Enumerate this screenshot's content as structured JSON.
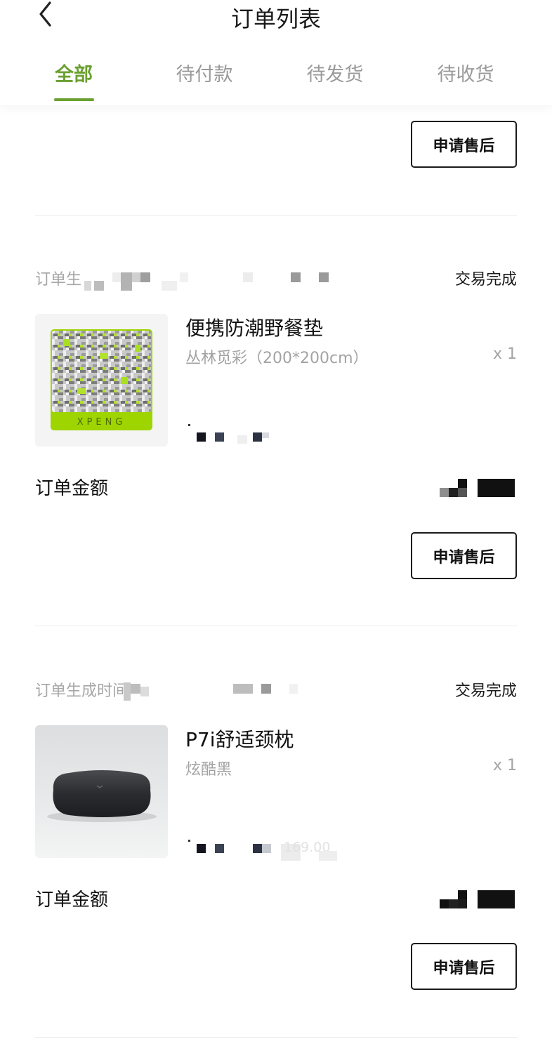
{
  "header": {
    "title": "订单列表",
    "back_icon": "chevron-left-icon"
  },
  "tabs": [
    {
      "label": "全部",
      "active": true
    },
    {
      "label": "待付款",
      "active": false
    },
    {
      "label": "待发货",
      "active": false
    },
    {
      "label": "待收货",
      "active": false
    }
  ],
  "accent_color": "#6aa02f",
  "orders": [
    {
      "after_sale_label": "申请售后"
    },
    {
      "time_label": "订单生",
      "status": "交易完成",
      "product_name": "便携防潮野餐垫",
      "product_variant": "丛林觅彩（200*200cm）",
      "quantity": "x 1",
      "amount_label": "订单金额",
      "after_sale_label": "申请售后",
      "product_logo": "XPENG"
    },
    {
      "time_label": "订单生成时间",
      "status": "交易完成",
      "product_name": "P7i舒适颈枕",
      "product_variant": "炫酷黑",
      "quantity": "x 1",
      "amount_label": "订单金额",
      "after_sale_label": "申请售后",
      "price_partial": "169.00"
    }
  ]
}
